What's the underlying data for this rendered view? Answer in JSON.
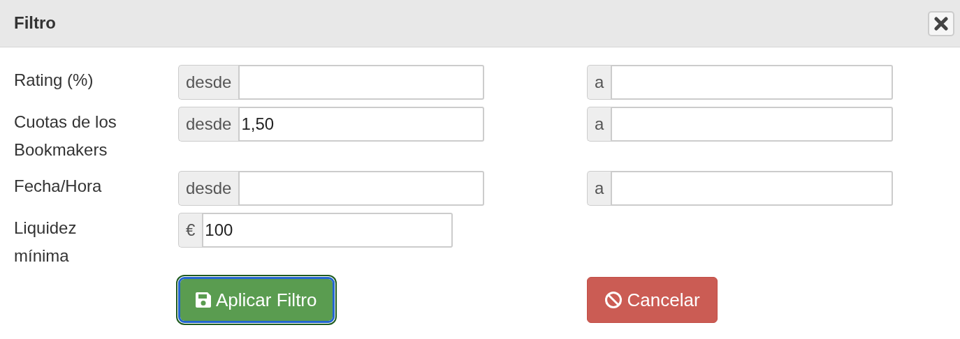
{
  "dialog": {
    "title": "Filtro"
  },
  "fields": [
    {
      "label": "Rating (%)",
      "groups": [
        {
          "addon": "desde"
        },
        {
          "addon": "a"
        }
      ]
    },
    {
      "label": "Cuotas de los Bookmakers",
      "groups": [
        {
          "addon": "desde",
          "value": "1,50"
        },
        {
          "addon": "a"
        }
      ]
    },
    {
      "label": "Fecha/Hora",
      "groups": [
        {
          "addon": "desde"
        },
        {
          "addon": "a"
        }
      ]
    },
    {
      "label": "Liquidez mínima",
      "groups": [
        {
          "addon": "€",
          "value": "100",
          "kind": "short"
        }
      ]
    }
  ],
  "buttons": [
    {
      "label": "Aplicar Filtro",
      "kind": "apply",
      "focused": true
    },
    {
      "label": "Cancelar",
      "kind": "cancel",
      "focused": false
    }
  ]
}
